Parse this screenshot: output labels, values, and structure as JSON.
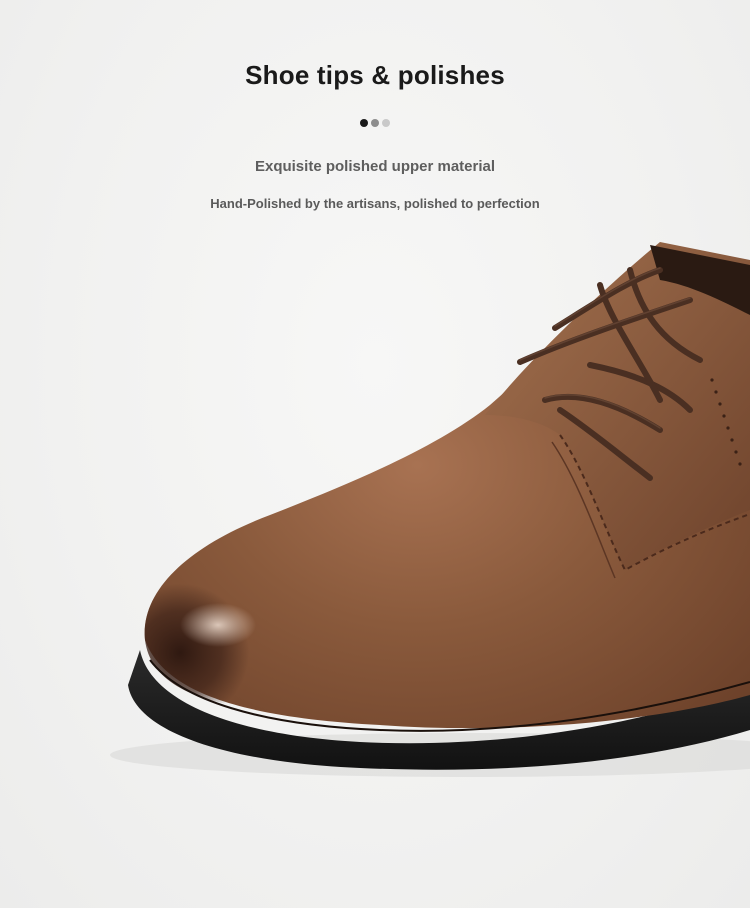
{
  "header": {
    "title": "Shoe tips & polishes",
    "carousel_dots": 3,
    "active_dot": 0
  },
  "content": {
    "subtitle": "Exquisite polished upper material",
    "description": "Hand-Polished by the artisans, polished to perfection"
  },
  "image": {
    "subject": "brown leather derby shoe toe close-up",
    "colors": {
      "leather": "#8a5a3c",
      "toe_dark": "#3d2218",
      "sole": "#1c1c1c",
      "lace": "#4a2f22"
    }
  }
}
